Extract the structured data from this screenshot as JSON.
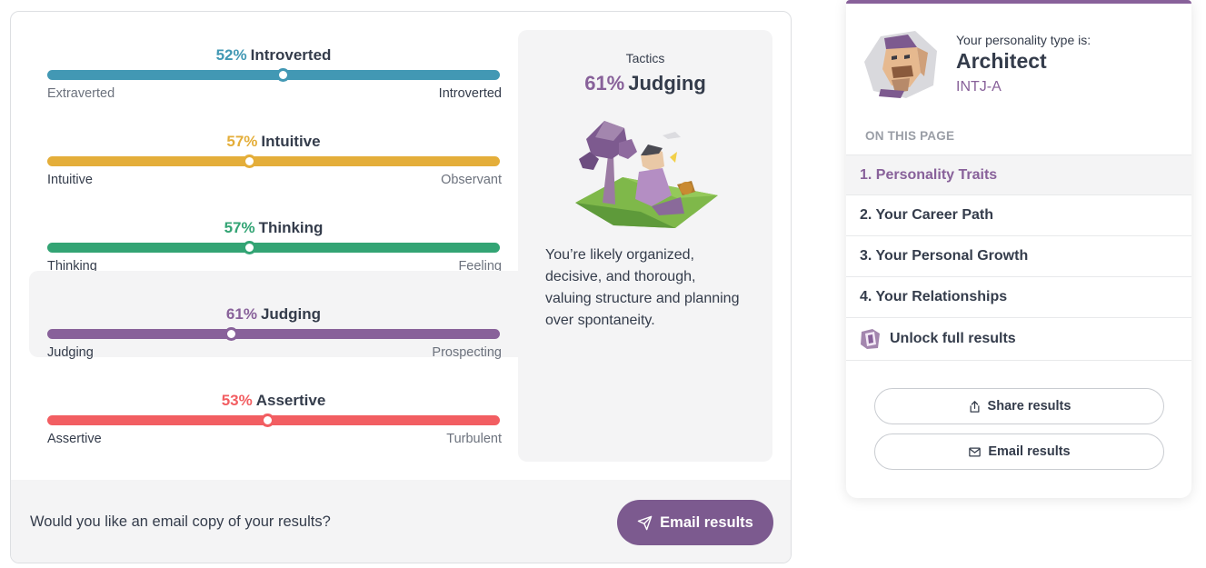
{
  "traits": [
    {
      "percent": "52%",
      "label": "Introverted",
      "left_pole": "Extraverted",
      "right_pole": "Introverted",
      "color": "#4298b4",
      "knob_fraction": 0.52,
      "dominant": "right"
    },
    {
      "percent": "57%",
      "label": "Intuitive",
      "left_pole": "Intuitive",
      "right_pole": "Observant",
      "color": "#e4ae3a",
      "knob_fraction": 0.445,
      "dominant": "left"
    },
    {
      "percent": "57%",
      "label": "Thinking",
      "left_pole": "Thinking",
      "right_pole": "Feeling",
      "color": "#33a474",
      "knob_fraction": 0.445,
      "dominant": "left"
    },
    {
      "percent": "61%",
      "label": "Judging",
      "left_pole": "Judging",
      "right_pole": "Prospecting",
      "color": "#88619a",
      "knob_fraction": 0.405,
      "dominant": "left"
    },
    {
      "percent": "53%",
      "label": "Assertive",
      "left_pole": "Assertive",
      "right_pole": "Turbulent",
      "color": "#f25e62",
      "knob_fraction": 0.485,
      "dominant": "left"
    }
  ],
  "detail": {
    "category": "Tactics",
    "percent": "61%",
    "label": "Judging",
    "description": "You’re likely organized, decisive, and thorough, valuing structure and planning over spontaneity."
  },
  "footer": {
    "prompt": "Would you like an email copy of your results?",
    "button_label": "Email results",
    "button_icon": "paper-plane-icon"
  },
  "sidebar": {
    "type_label": "Your personality type is:",
    "type_name": "Architect",
    "type_code": "INTJ-A",
    "toc_heading": "ON THIS PAGE",
    "toc": [
      "1. Personality Traits",
      "2. Your Career Path",
      "3. Your Personal Growth",
      "4. Your Relationships"
    ],
    "unlock_label": "Unlock full results",
    "share_label": "Share results",
    "email_label": "Email results",
    "accent_color": "#88619a"
  }
}
